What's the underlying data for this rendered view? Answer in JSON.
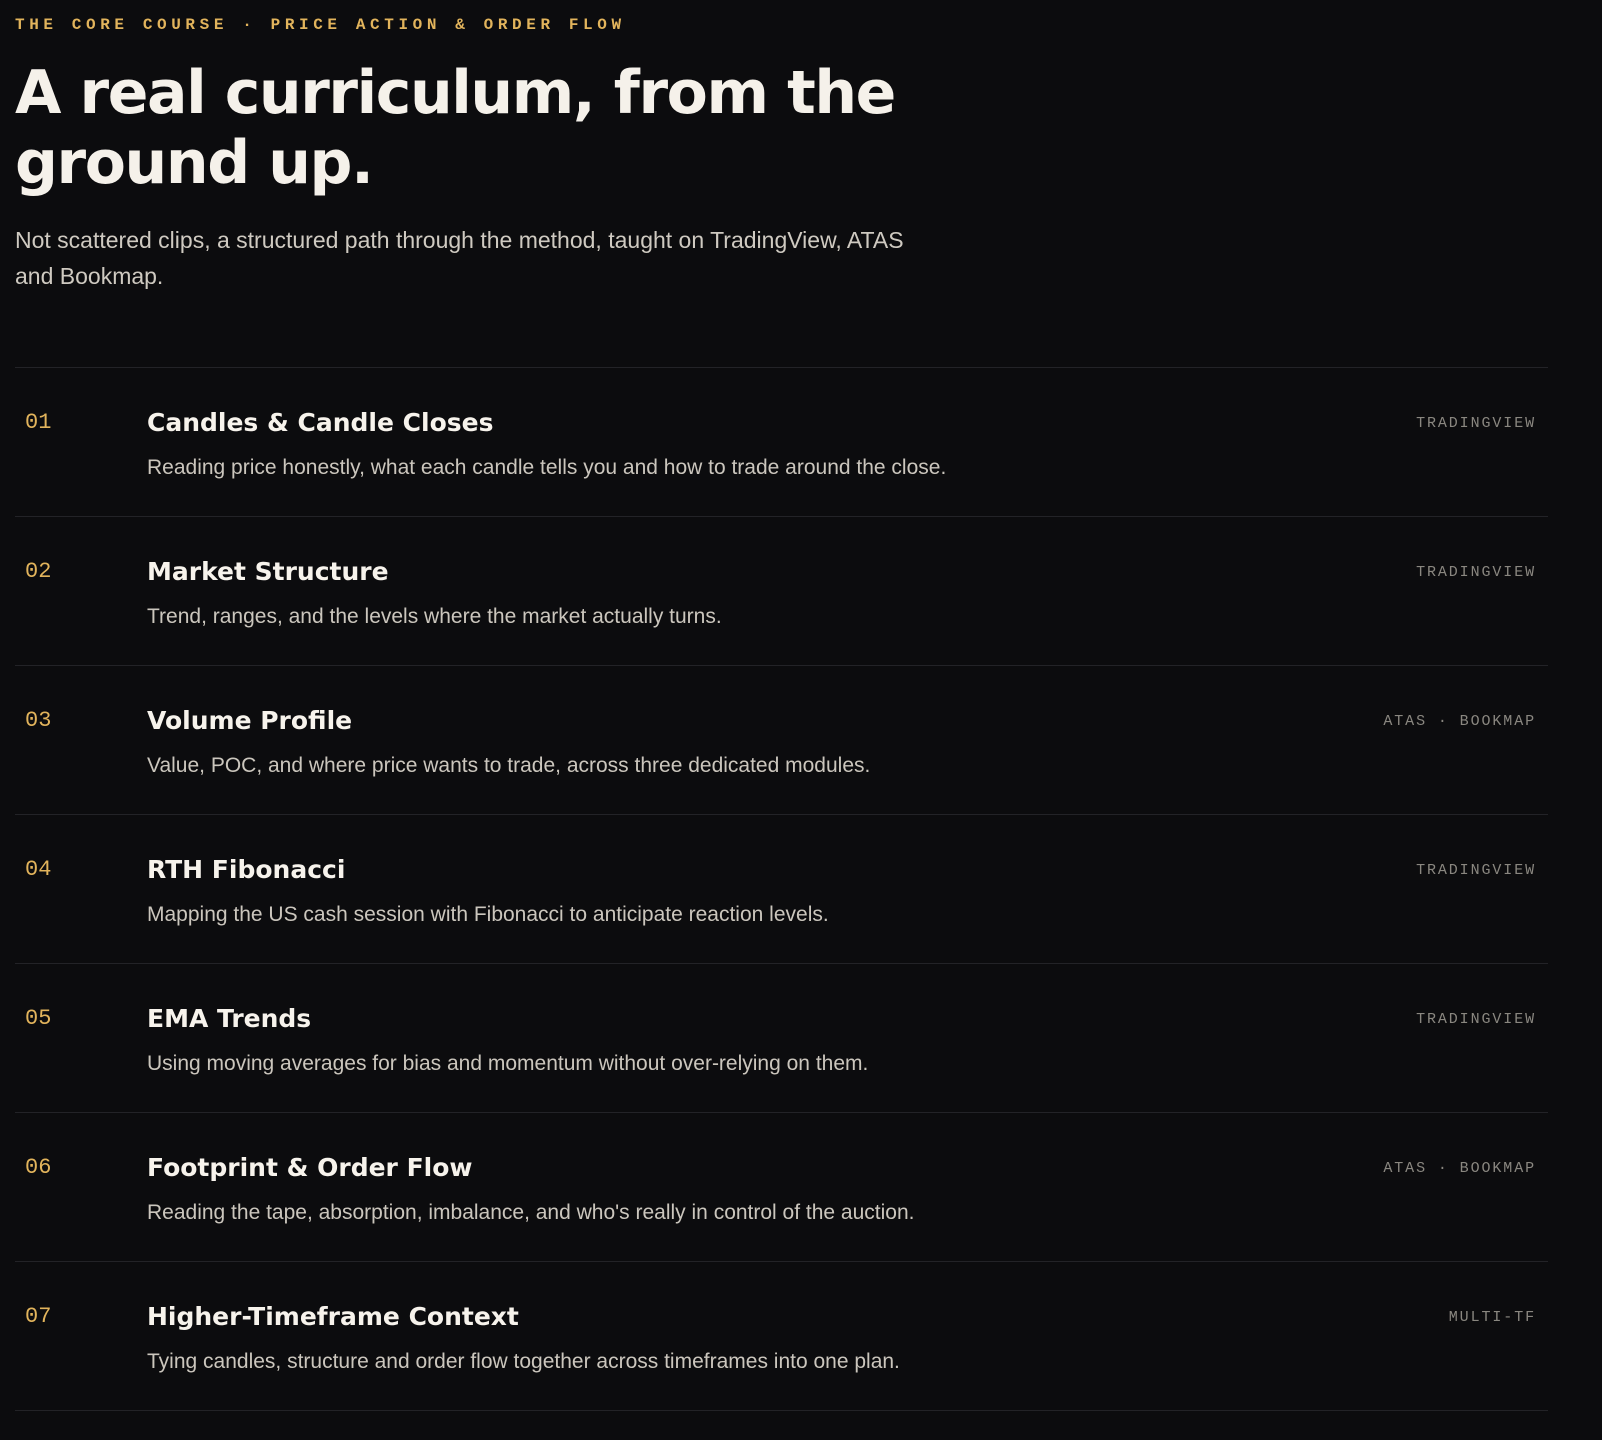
{
  "header": {
    "eyebrow": "THE CORE COURSE · PRICE ACTION & ORDER FLOW",
    "headline": "A real curriculum, from the ground up.",
    "lede": "Not scattered clips, a structured path through the method, taught on TradingView, ATAS and Bookmap."
  },
  "modules": [
    {
      "number": "01",
      "title": "Candles & Candle Closes",
      "description": "Reading price honestly, what each candle tells you and how to trade around the close.",
      "tag": "TRADINGVIEW"
    },
    {
      "number": "02",
      "title": "Market Structure",
      "description": "Trend, ranges, and the levels where the market actually turns.",
      "tag": "TRADINGVIEW"
    },
    {
      "number": "03",
      "title": "Volume Profile",
      "description": "Value, POC, and where price wants to trade, across three dedicated modules.",
      "tag": "ATAS · BOOKMAP"
    },
    {
      "number": "04",
      "title": "RTH Fibonacci",
      "description": "Mapping the US cash session with Fibonacci to anticipate reaction levels.",
      "tag": "TRADINGVIEW"
    },
    {
      "number": "05",
      "title": "EMA Trends",
      "description": "Using moving averages for bias and momentum without over-relying on them.",
      "tag": "TRADINGVIEW"
    },
    {
      "number": "06",
      "title": "Footprint & Order Flow",
      "description": "Reading the tape, absorption, imbalance, and who's really in control of the auction.",
      "tag": "ATAS · BOOKMAP"
    },
    {
      "number": "07",
      "title": "Higher-Timeframe Context",
      "description": "Tying candles, structure and order flow together across timeframes into one plan.",
      "tag": "MULTI-TF"
    }
  ],
  "colors": {
    "background": "#0c0c0e",
    "accent": "#e2b45c",
    "heading": "#f5f1ea",
    "body_text": "#cbc6bd",
    "muted_tag": "#8a8780",
    "divider": "#232327"
  }
}
